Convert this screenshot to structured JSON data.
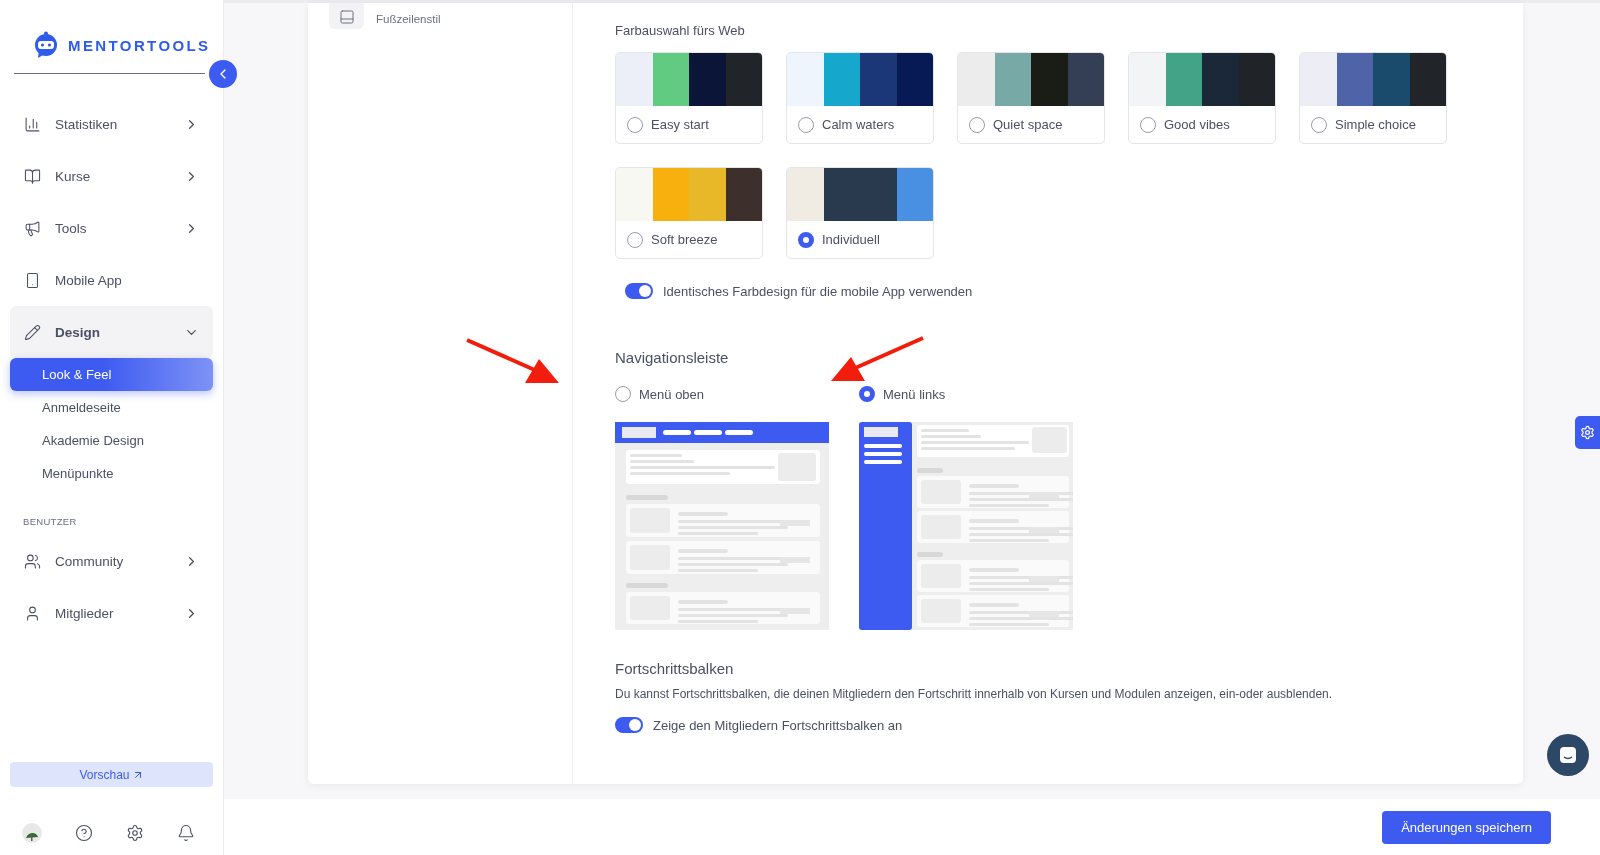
{
  "sidebar": {
    "logo": "MENTORTOOLS",
    "items": [
      {
        "label": "Statistiken",
        "kind": "group",
        "expanded": false
      },
      {
        "label": "Kurse",
        "kind": "group",
        "expanded": false
      },
      {
        "label": "Tools",
        "kind": "group",
        "expanded": false
      },
      {
        "label": "Mobile App",
        "kind": "link"
      },
      {
        "label": "Design",
        "kind": "group",
        "expanded": true,
        "children": [
          {
            "label": "Look & Feel",
            "selected": true
          },
          {
            "label": "Anmeldeseite",
            "selected": false
          },
          {
            "label": "Akademie Design",
            "selected": false
          },
          {
            "label": "Menüpunkte",
            "selected": false
          }
        ]
      }
    ],
    "section": "BENUTZER",
    "section_items": [
      {
        "label": "Community",
        "kind": "group",
        "expanded": false
      },
      {
        "label": "Mitglieder",
        "kind": "group",
        "expanded": false
      }
    ],
    "preview_button": "Vorschau"
  },
  "settings_menu": {
    "item": "Fußzeilenstil"
  },
  "colors": {
    "title": "Farbauswahl fürs Web",
    "palettes": [
      {
        "name": "Easy start",
        "selected": false,
        "swatches": [
          {
            "color": "#eceff8"
          },
          {
            "color": "#62cb82"
          },
          {
            "color": "#0b1538"
          },
          {
            "color": "#212529"
          }
        ]
      },
      {
        "name": "Calm waters",
        "selected": false,
        "swatches": [
          {
            "color": "#eff5fd"
          },
          {
            "color": "#15a8cc"
          },
          {
            "color": "#1c3778"
          },
          {
            "color": "#081a55"
          }
        ]
      },
      {
        "name": "Quiet space",
        "selected": false,
        "swatches": [
          {
            "color": "#ececec"
          },
          {
            "color": "#77aaa6"
          },
          {
            "color": "#1a1d16"
          },
          {
            "color": "#343f55"
          }
        ]
      },
      {
        "name": "Good vibes",
        "selected": false,
        "swatches": [
          {
            "color": "#f3f4f6"
          },
          {
            "color": "#43a386"
          },
          {
            "color": "#1a2838"
          },
          {
            "color": "#202327"
          }
        ]
      },
      {
        "name": "Simple choice",
        "selected": false,
        "swatches": [
          {
            "color": "#ecedf5"
          },
          {
            "color": "#4f64a8"
          },
          {
            "color": "#1a4a6c"
          },
          {
            "color": "#212529"
          }
        ]
      },
      {
        "name": "Soft breeze",
        "selected": false,
        "swatches": [
          {
            "color": "#f7f8f2"
          },
          {
            "color": "#f8b00f"
          },
          {
            "color": "#e8b828"
          },
          {
            "color": "#3c2f2c"
          }
        ]
      },
      {
        "name": "Individuell",
        "selected": true,
        "swatches": [
          {
            "color": "#f0ebe3"
          },
          {
            "color": "#293a4f"
          },
          {
            "color": "#293a4f"
          },
          {
            "color": "#4a90e2"
          }
        ]
      }
    ],
    "mobile_toggle": {
      "label": "Identisches Farbdesign für die mobile App verwenden",
      "on": true
    }
  },
  "navigation": {
    "title": "Navigationsleiste",
    "options": [
      {
        "label": "Menü oben",
        "selected": false,
        "kind": "top"
      },
      {
        "label": "Menü links",
        "selected": true,
        "kind": "left"
      }
    ]
  },
  "progress": {
    "title": "Fortschrittsbalken",
    "description": "Du kannst Fortschrittsbalken, die deinen Mitgliedern den Fortschritt innerhalb von Kursen und Modulen anzeigen, ein-oder ausblenden.",
    "toggle": {
      "label": "Zeige den Mitgliedern Fortschrittsbalken an",
      "on": true
    }
  },
  "save_button": "Änderungen speichern"
}
